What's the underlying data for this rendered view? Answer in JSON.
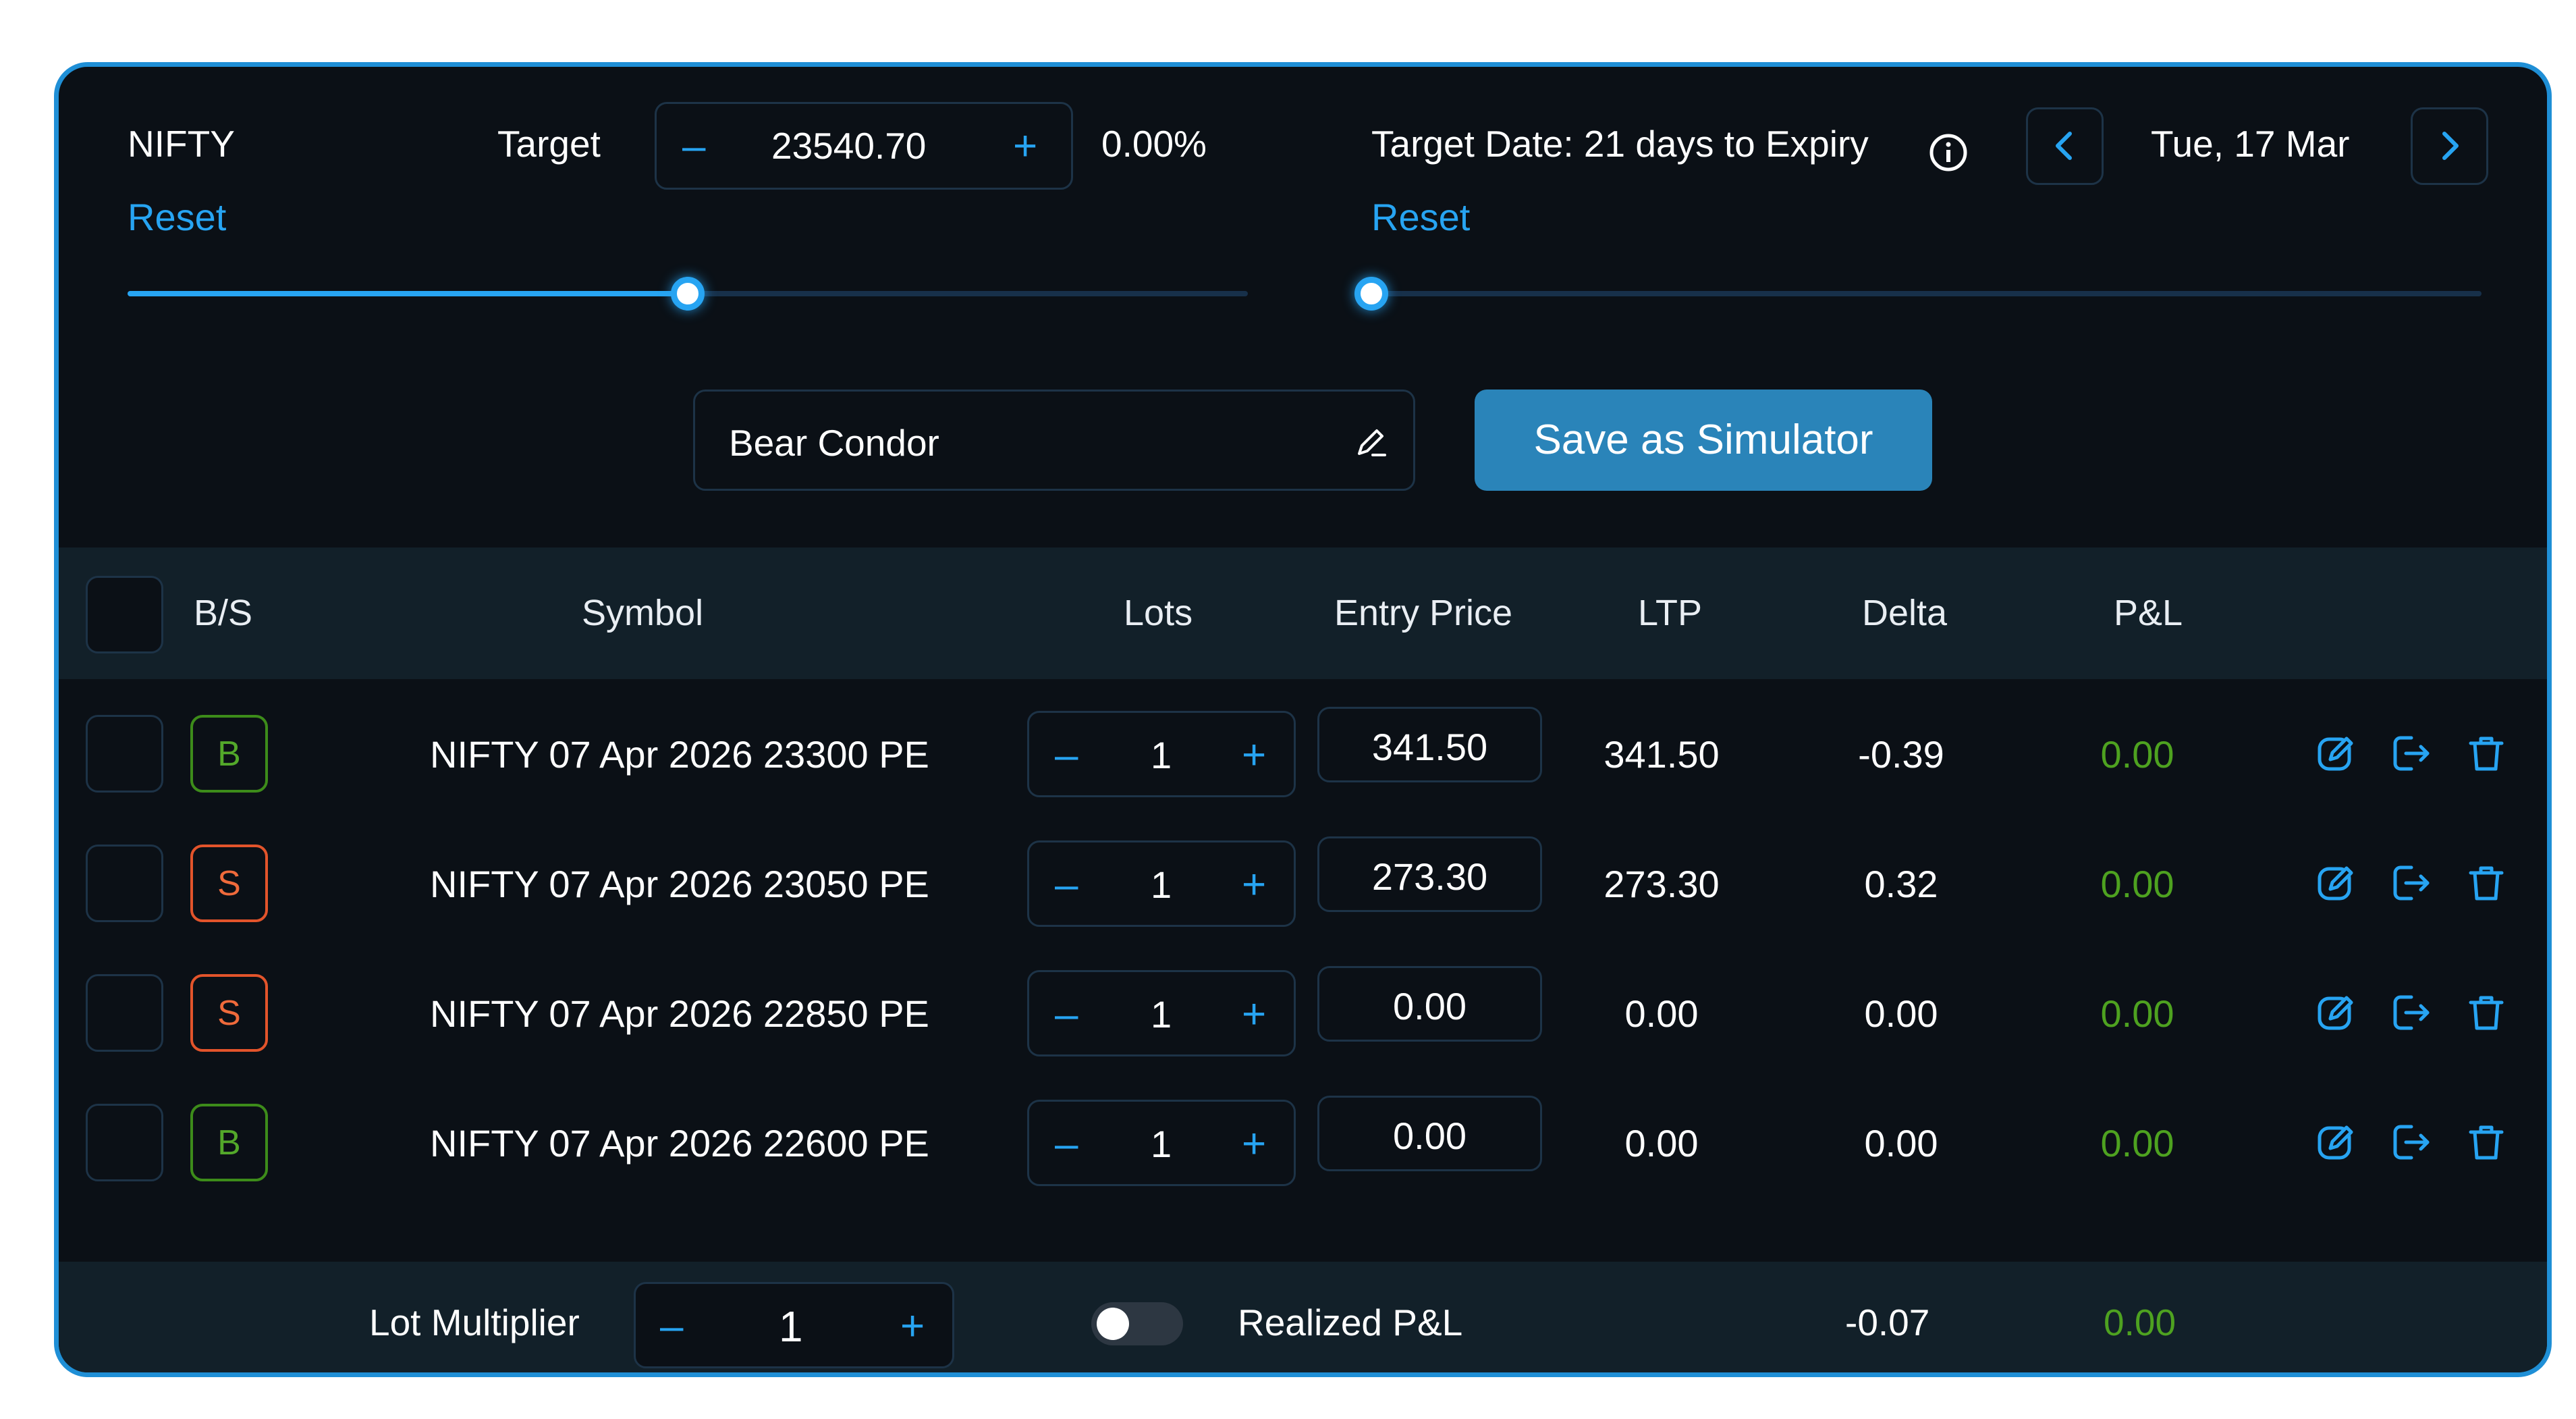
{
  "top_left": {
    "symbol": "NIFTY",
    "target_label": "Target",
    "target_value": "23540.70",
    "minus": "–",
    "plus": "+",
    "change_pct": "0.00%",
    "reset": "Reset",
    "slider_level": 0.5
  },
  "top_right": {
    "target_date_label": "Target Date: 21 days to Expiry",
    "date": "Tue, 17 Mar",
    "reset": "Reset",
    "slider_level": 0.0
  },
  "strategy": {
    "name": "Bear Condor",
    "save_button": "Save as Simulator"
  },
  "table": {
    "headers": {
      "bs": "B/S",
      "symbol": "Symbol",
      "lots": "Lots",
      "entry_price": "Entry Price",
      "ltp": "LTP",
      "delta": "Delta",
      "pnl": "P&L"
    },
    "rows": [
      {
        "side": "B",
        "symbol": "NIFTY 07 Apr 2026 23300 PE",
        "lots": "1",
        "entry": "341.50",
        "ltp": "341.50",
        "delta": "-0.39",
        "pnl": "0.00"
      },
      {
        "side": "S",
        "symbol": "NIFTY 07 Apr 2026 23050 PE",
        "lots": "1",
        "entry": "273.30",
        "ltp": "273.30",
        "delta": "0.32",
        "pnl": "0.00"
      },
      {
        "side": "S",
        "symbol": "NIFTY 07 Apr 2026 22850 PE",
        "lots": "1",
        "entry": "0.00",
        "ltp": "0.00",
        "delta": "0.00",
        "pnl": "0.00"
      },
      {
        "side": "B",
        "symbol": "NIFTY 07 Apr 2026 22600 PE",
        "lots": "1",
        "entry": "0.00",
        "ltp": "0.00",
        "delta": "0.00",
        "pnl": "0.00"
      }
    ]
  },
  "footer": {
    "lot_multiplier_label": "Lot Multiplier",
    "lot_multiplier": "1",
    "realized_label": "Realized P&L",
    "total_delta": "-0.07",
    "total_pnl": "0.00",
    "realized_toggle_on": false
  },
  "colors": {
    "accent": "#27a4f2",
    "buy": "#53a82a",
    "sell": "#ef6a3b",
    "pnl": "#4ea220",
    "save_button": "#2a84b9"
  },
  "icons": [
    "info-icon",
    "chevron-left-icon",
    "chevron-right-icon",
    "pencil-icon",
    "edit-icon",
    "exit-icon",
    "trash-icon"
  ]
}
